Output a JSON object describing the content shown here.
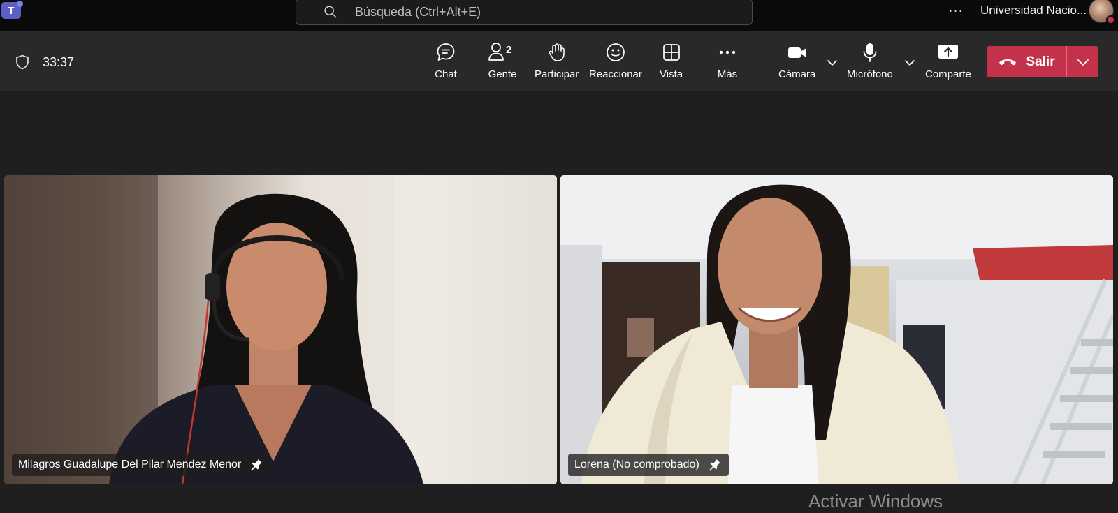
{
  "app": {
    "logo_text": "T"
  },
  "search": {
    "placeholder": "Búsqueda (Ctrl+Alt+E)"
  },
  "titlebar": {
    "more_label": "···",
    "organization": "Universidad Nacio..."
  },
  "meeting": {
    "elapsed": "33:37"
  },
  "toolbar": {
    "chat_label": "Chat",
    "people_label": "Gente",
    "people_count": "2",
    "raise_hand_label": "Participar",
    "react_label": "Reaccionar",
    "view_label": "Vista",
    "more_label": "Más",
    "camera_label": "Cámara",
    "mic_label": "Micrófono",
    "share_label": "Comparte",
    "leave_label": "Salir"
  },
  "participants": [
    {
      "name": "Milagros Guadalupe Del Pilar Mendez Menor"
    },
    {
      "name": "Lorena (No comprobado)"
    }
  ],
  "overlay": {
    "watermark": "Activar Windows"
  },
  "colors": {
    "leave_red": "#c4314b",
    "titlebar_bg": "#0a0a0a",
    "toolbar_bg": "#292929",
    "stage_bg": "#1f1f1f",
    "teams_purple": "#5b5fc7"
  }
}
